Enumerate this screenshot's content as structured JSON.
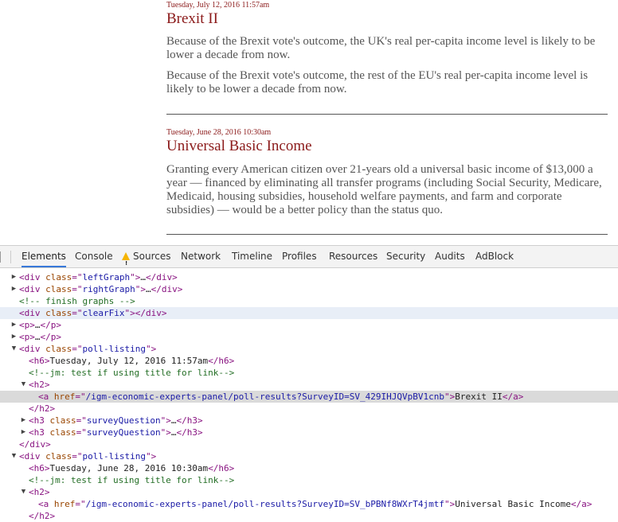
{
  "posts": [
    {
      "date": "Tuesday, July 12, 2016 11:57am",
      "title": "Brexit II",
      "questions": [
        "Because of the Brexit vote's outcome, the UK's real per-capita income level is likely to be lower a decade from now.",
        "Because of the Brexit vote's outcome, the rest of the EU's real per-capita income level is likely to be lower a decade from now."
      ]
    },
    {
      "date": "Tuesday, June 28, 2016 10:30am",
      "title": "Universal Basic Income",
      "questions": [
        "Granting every American citizen over 21-years old a universal basic income of $13,000 a year — financed by eliminating all transfer programs (including Social Security, Medicare, Medicaid, housing subsidies, household welfare payments, and farm and corporate subsidies) — would be a better policy than the status quo."
      ]
    }
  ],
  "devtools": {
    "tabs": [
      "Elements",
      "Console",
      "Sources",
      "Network",
      "Timeline",
      "Profiles",
      "Resources",
      "Security",
      "Audits",
      "AdBlock"
    ],
    "active_tab": "Elements",
    "sources_warning_icon": "warning-icon",
    "rows": [
      {
        "indent": 0,
        "toggle": "▶",
        "parts": [
          [
            "tag",
            "<div "
          ],
          [
            "an",
            "class"
          ],
          [
            "tag",
            "=\""
          ],
          [
            "av",
            "leftGraph"
          ],
          [
            "tag",
            "\">"
          ],
          [
            "tx",
            "…"
          ],
          [
            "tag",
            "</div>"
          ]
        ]
      },
      {
        "indent": 0,
        "toggle": "▶",
        "parts": [
          [
            "tag",
            "<div "
          ],
          [
            "an",
            "class"
          ],
          [
            "tag",
            "=\""
          ],
          [
            "av",
            "rightGraph"
          ],
          [
            "tag",
            "\">"
          ],
          [
            "tx",
            "…"
          ],
          [
            "tag",
            "</div>"
          ]
        ]
      },
      {
        "indent": 0,
        "toggle": "",
        "parts": [
          [
            "cm",
            "<!-- finish graphs -->"
          ]
        ]
      },
      {
        "indent": 0,
        "toggle": "",
        "highlight": "hl1",
        "parts": [
          [
            "tag",
            "<div "
          ],
          [
            "an",
            "class"
          ],
          [
            "tag",
            "=\""
          ],
          [
            "av",
            "clearFix"
          ],
          [
            "tag",
            "\"></div>"
          ]
        ]
      },
      {
        "indent": 0,
        "toggle": "▶",
        "parts": [
          [
            "tag",
            "<p>"
          ],
          [
            "tx",
            "…"
          ],
          [
            "tag",
            "</p>"
          ]
        ]
      },
      {
        "indent": 0,
        "toggle": "▶",
        "parts": [
          [
            "tag",
            "<p>"
          ],
          [
            "tx",
            "…"
          ],
          [
            "tag",
            "</p>"
          ]
        ]
      },
      {
        "indent": 0,
        "toggle": "▼",
        "parts": [
          [
            "tag",
            "<div "
          ],
          [
            "an",
            "class"
          ],
          [
            "tag",
            "=\""
          ],
          [
            "av",
            "poll-listing"
          ],
          [
            "tag",
            "\">"
          ]
        ]
      },
      {
        "indent": 1,
        "toggle": "",
        "parts": [
          [
            "tag",
            "<h6>"
          ],
          [
            "tx",
            "Tuesday, July 12, 2016 11:57am"
          ],
          [
            "tag",
            "</h6>"
          ]
        ]
      },
      {
        "indent": 1,
        "toggle": "",
        "parts": [
          [
            "cm",
            "<!--jm: test if using title for link-->"
          ]
        ]
      },
      {
        "indent": 1,
        "toggle": "▼",
        "parts": [
          [
            "tag",
            "<h2>"
          ]
        ]
      },
      {
        "indent": 2,
        "toggle": "",
        "highlight": "hl2",
        "parts": [
          [
            "tag",
            "<a "
          ],
          [
            "an",
            "href"
          ],
          [
            "tag",
            "=\""
          ],
          [
            "av",
            "/igm-economic-experts-panel/poll-results?SurveyID=SV_429IHJQVpBV1cnb"
          ],
          [
            "tag",
            "\">"
          ],
          [
            "tx",
            "Brexit II"
          ],
          [
            "tag",
            "</a>"
          ]
        ]
      },
      {
        "indent": 1,
        "toggle": "",
        "parts": [
          [
            "tag",
            "</h2>"
          ]
        ]
      },
      {
        "indent": 1,
        "toggle": "▶",
        "parts": [
          [
            "tag",
            "<h3 "
          ],
          [
            "an",
            "class"
          ],
          [
            "tag",
            "=\""
          ],
          [
            "av",
            "surveyQuestion"
          ],
          [
            "tag",
            "\">"
          ],
          [
            "tx",
            "…"
          ],
          [
            "tag",
            "</h3>"
          ]
        ]
      },
      {
        "indent": 1,
        "toggle": "▶",
        "parts": [
          [
            "tag",
            "<h3 "
          ],
          [
            "an",
            "class"
          ],
          [
            "tag",
            "=\""
          ],
          [
            "av",
            "surveyQuestion"
          ],
          [
            "tag",
            "\">"
          ],
          [
            "tx",
            "…"
          ],
          [
            "tag",
            "</h3>"
          ]
        ]
      },
      {
        "indent": 0,
        "toggle": "",
        "parts": [
          [
            "tag",
            "</div>"
          ]
        ]
      },
      {
        "indent": 0,
        "toggle": "▼",
        "parts": [
          [
            "tag",
            "<div "
          ],
          [
            "an",
            "class"
          ],
          [
            "tag",
            "=\""
          ],
          [
            "av",
            "poll-listing"
          ],
          [
            "tag",
            "\">"
          ]
        ]
      },
      {
        "indent": 1,
        "toggle": "",
        "parts": [
          [
            "tag",
            "<h6>"
          ],
          [
            "tx",
            "Tuesday, June 28, 2016 10:30am"
          ],
          [
            "tag",
            "</h6>"
          ]
        ]
      },
      {
        "indent": 1,
        "toggle": "",
        "parts": [
          [
            "cm",
            "<!--jm: test if using title for link-->"
          ]
        ]
      },
      {
        "indent": 1,
        "toggle": "▼",
        "parts": [
          [
            "tag",
            "<h2>"
          ]
        ]
      },
      {
        "indent": 2,
        "toggle": "",
        "parts": [
          [
            "tag",
            "<a "
          ],
          [
            "an",
            "href"
          ],
          [
            "tag",
            "=\""
          ],
          [
            "av",
            "/igm-economic-experts-panel/poll-results?SurveyID=SV_bPBNf8WXrT4jmtf"
          ],
          [
            "tag",
            "\">"
          ],
          [
            "tx",
            "Universal Basic Income"
          ],
          [
            "tag",
            "</a>"
          ]
        ]
      },
      {
        "indent": 1,
        "toggle": "",
        "parts": [
          [
            "tag",
            "</h2>"
          ]
        ]
      }
    ]
  }
}
